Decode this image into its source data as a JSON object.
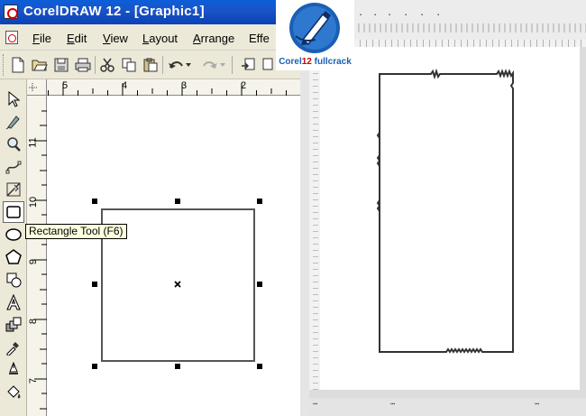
{
  "left_window": {
    "title": "CorelDRAW 12 - [Graphic1]",
    "menu": [
      {
        "label": "File",
        "mnemonic": "F"
      },
      {
        "label": "Edit",
        "mnemonic": "E"
      },
      {
        "label": "View",
        "mnemonic": "V"
      },
      {
        "label": "Layout",
        "mnemonic": "L"
      },
      {
        "label": "Arrange",
        "mnemonic": "A"
      },
      {
        "label": "Effe",
        "mnemonic": ""
      }
    ],
    "toolbar_icons": [
      "new-icon",
      "open-icon",
      "save-icon",
      "print-icon",
      "cut-icon",
      "copy-icon",
      "paste-icon",
      "undo-icon",
      "redo-icon",
      "import-icon",
      "export-icon"
    ],
    "hruler_labels": [
      "5",
      "4",
      "3",
      "2"
    ],
    "vruler_labels": [
      "11",
      "10",
      "9",
      "8",
      "7"
    ],
    "tools": [
      "pick-tool-icon",
      "shape-tool-icon",
      "zoom-tool-icon",
      "freehand-tool-icon",
      "smart-fill-tool-icon",
      "rectangle-tool-icon",
      "ellipse-tool-icon",
      "polygon-tool-icon",
      "basic-shapes-tool-icon",
      "text-tool-icon",
      "interactive-blend-tool-icon",
      "eyedropper-tool-icon",
      "outline-tool-icon",
      "fill-tool-icon"
    ],
    "active_tool": "rectangle-tool-icon",
    "tooltip": "Rectangle Tool (F6)"
  },
  "watermark": {
    "brand": "Corel",
    "version": "12",
    "tagline": "fullcrack"
  },
  "colors": {
    "title_blue": "#0a5fd8",
    "ui_beige": "#ece9d8",
    "tooltip_yellow": "#ffffe1",
    "watermark_blue": "#1a5fb4"
  }
}
